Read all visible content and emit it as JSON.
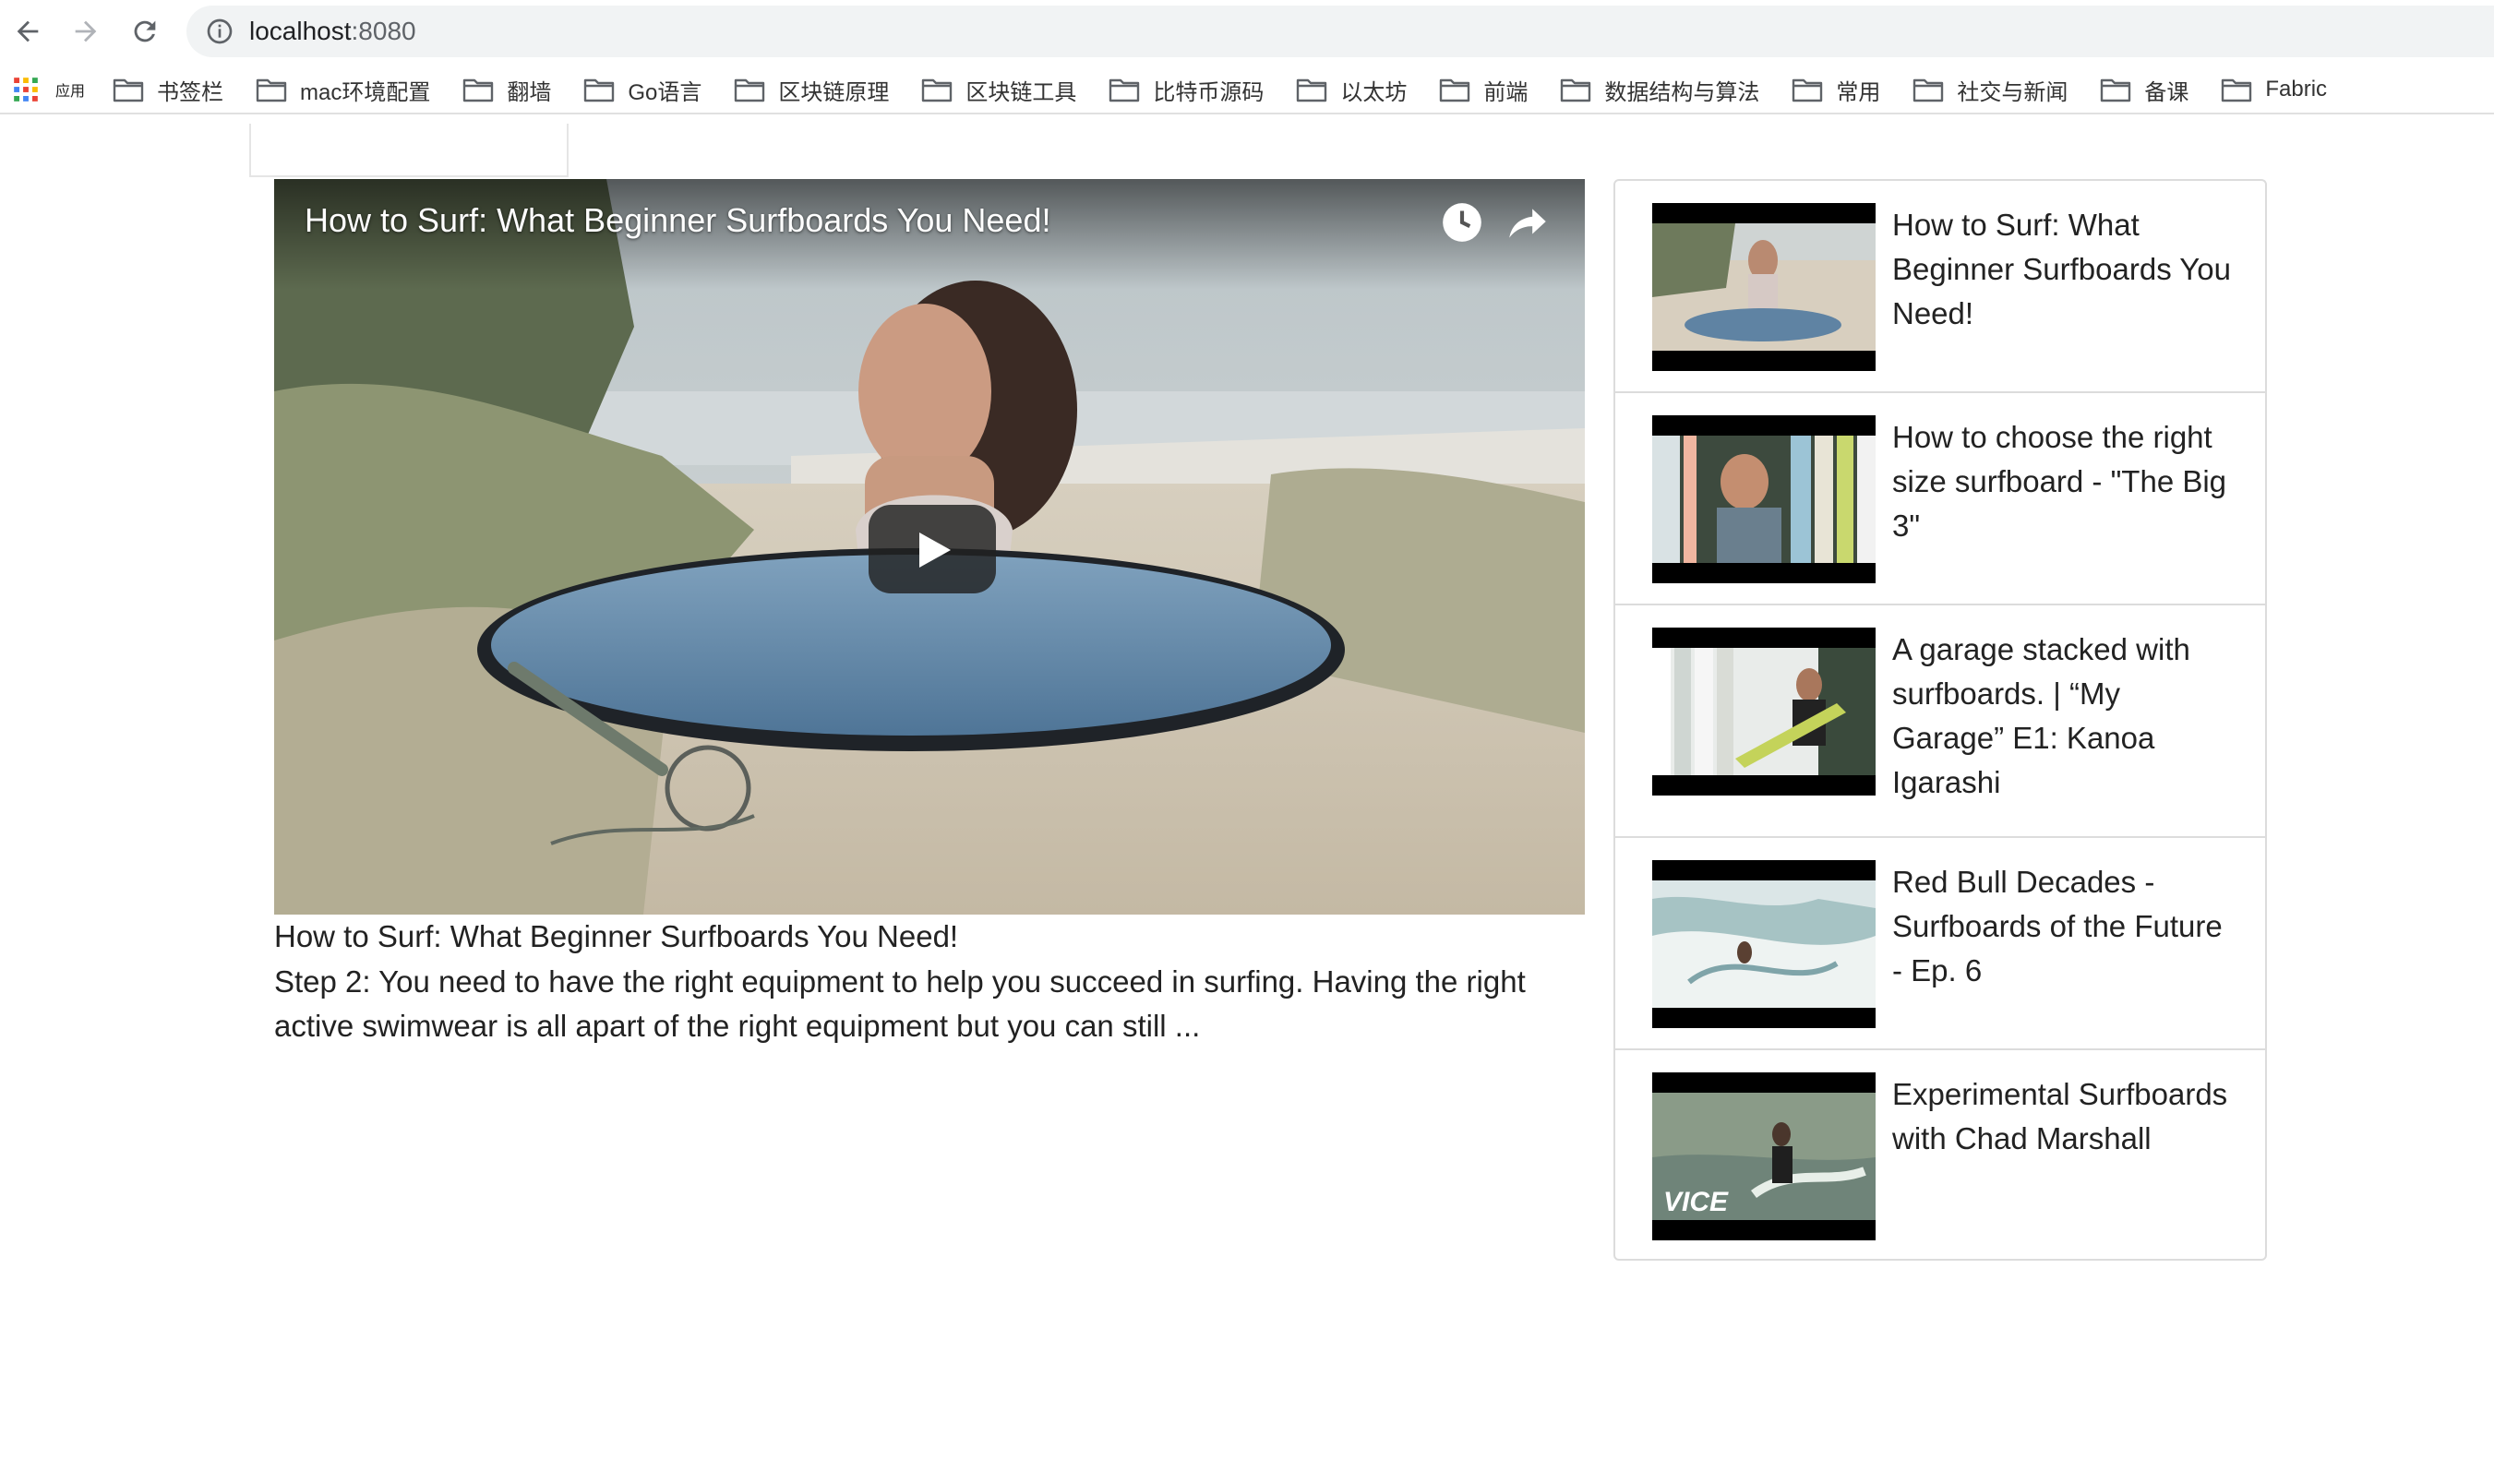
{
  "browser": {
    "url_host": "localhost",
    "url_port": ":8080",
    "apps_label": "应用",
    "bookmarks": [
      "书签栏",
      "mac环境配置",
      "翻墙",
      "Go语言",
      "区块链原理",
      "区块链工具",
      "比特币源码",
      "以太坊",
      "前端",
      "数据结构与算法",
      "常用",
      "社交与新闻",
      "备课",
      "Fabric"
    ]
  },
  "player": {
    "title": "How to Surf: What Beginner Surfboards You Need!",
    "icons": [
      "clock-icon",
      "share-icon",
      "play-icon"
    ]
  },
  "detail": {
    "title": "How to Surf: What Beginner Surfboards You Need!",
    "description": "Step 2: You need to have the right equipment to help you succeed in surfing. Having the right active swimwear is all apart of the right equipment but you can still ..."
  },
  "video_list": [
    {
      "title": "How to Surf: What Beginner Surfboards You Need!"
    },
    {
      "title": "How to choose the right size surfboard - \"The Big 3\""
    },
    {
      "title": "A garage stacked with surfboards. | “My Garage” E1: Kanoa Igarashi"
    },
    {
      "title": "Red Bull Decades - Surfboards of the Future - Ep. 6"
    },
    {
      "title": "Experimental Surfboards with Chad Marshall"
    }
  ],
  "thumb_watermark": "VICE"
}
